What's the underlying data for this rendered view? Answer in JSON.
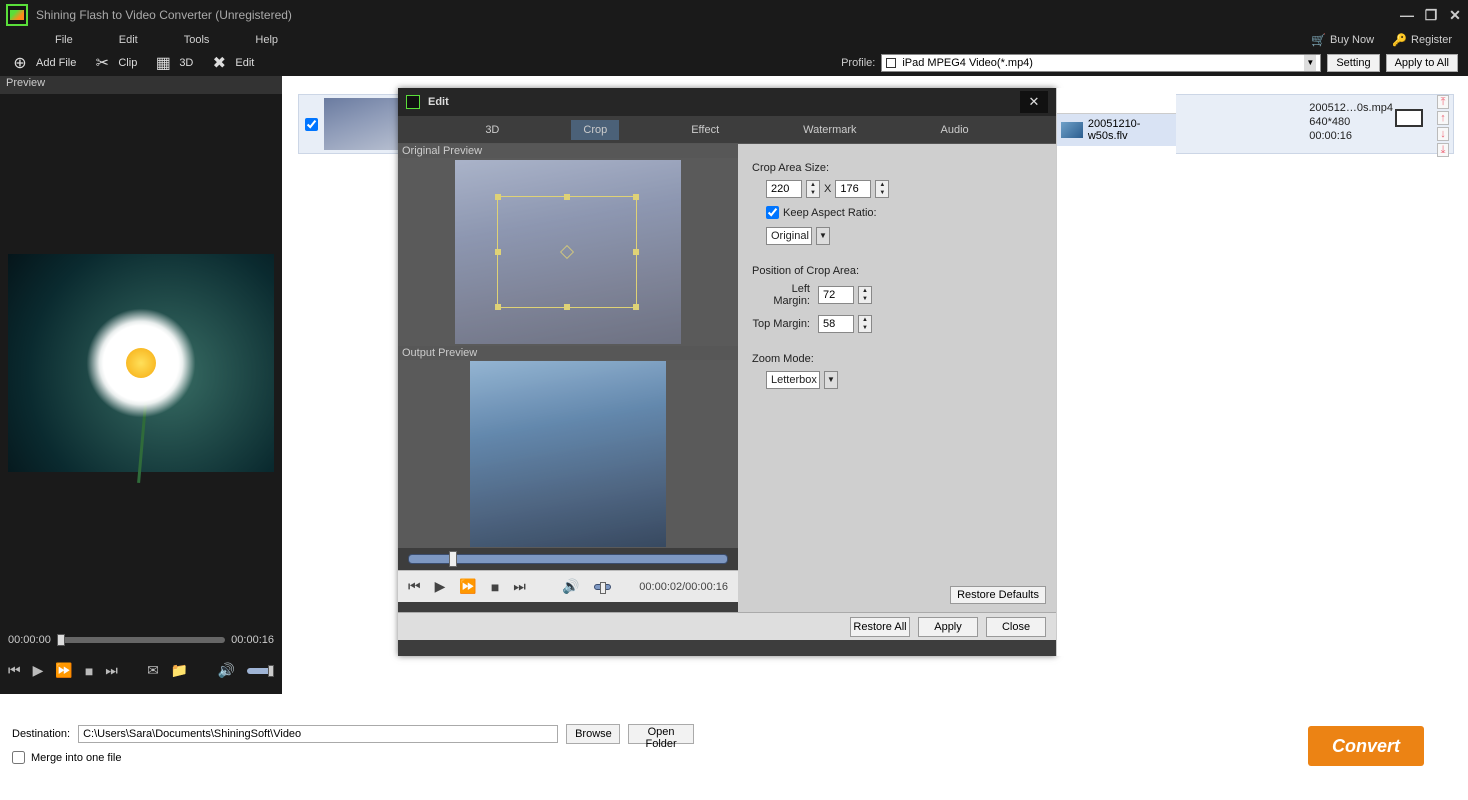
{
  "app": {
    "title": "Shining Flash to Video Converter (Unregistered)"
  },
  "menus": {
    "file": "File",
    "edit": "Edit",
    "tools": "Tools",
    "help": "Help"
  },
  "links": {
    "buy": "Buy Now",
    "register": "Register"
  },
  "toolbar": {
    "addfile": "Add File",
    "clip": "Clip",
    "threed": "3D",
    "edit": "Edit"
  },
  "profile": {
    "label": "Profile:",
    "value": "iPad MPEG4 Video(*.mp4)",
    "setting": "Setting",
    "apply": "Apply to All"
  },
  "preview": {
    "label": "Preview",
    "time_start": "00:00:00",
    "time_end": "00:00:16"
  },
  "file_item": {
    "name": "200512…0s.mp4",
    "size": "640*480",
    "dur": "00:00:16"
  },
  "edit_dialog": {
    "title": "Edit",
    "tabs": {
      "threed": "3D",
      "crop": "Crop",
      "effect": "Effect",
      "watermark": "Watermark",
      "audio": "Audio"
    },
    "orig": "Original Preview",
    "out": "Output Preview",
    "time": "00:00:02/00:00:16",
    "sidefile": "20051210-w50s.flv",
    "crop_area_label": "Crop Area Size:",
    "crop_w": "220",
    "crop_x": "X",
    "crop_h": "176",
    "keep_ar": "Keep Aspect Ratio:",
    "ar_value": "Original",
    "pos_label": "Position of Crop Area:",
    "left_margin_label": "Left Margin:",
    "left_margin": "72",
    "top_margin_label": "Top Margin:",
    "top_margin": "58",
    "zoom_label": "Zoom Mode:",
    "zoom_value": "Letterbox",
    "restore_defaults": "Restore Defaults",
    "restore_all": "Restore All",
    "apply": "Apply",
    "close": "Close"
  },
  "bottom": {
    "dest_label": "Destination:",
    "dest_path": "C:\\Users\\Sara\\Documents\\ShiningSoft\\Video",
    "browse": "Browse",
    "open": "Open Folder",
    "merge": "Merge into one file",
    "convert": "Convert"
  }
}
